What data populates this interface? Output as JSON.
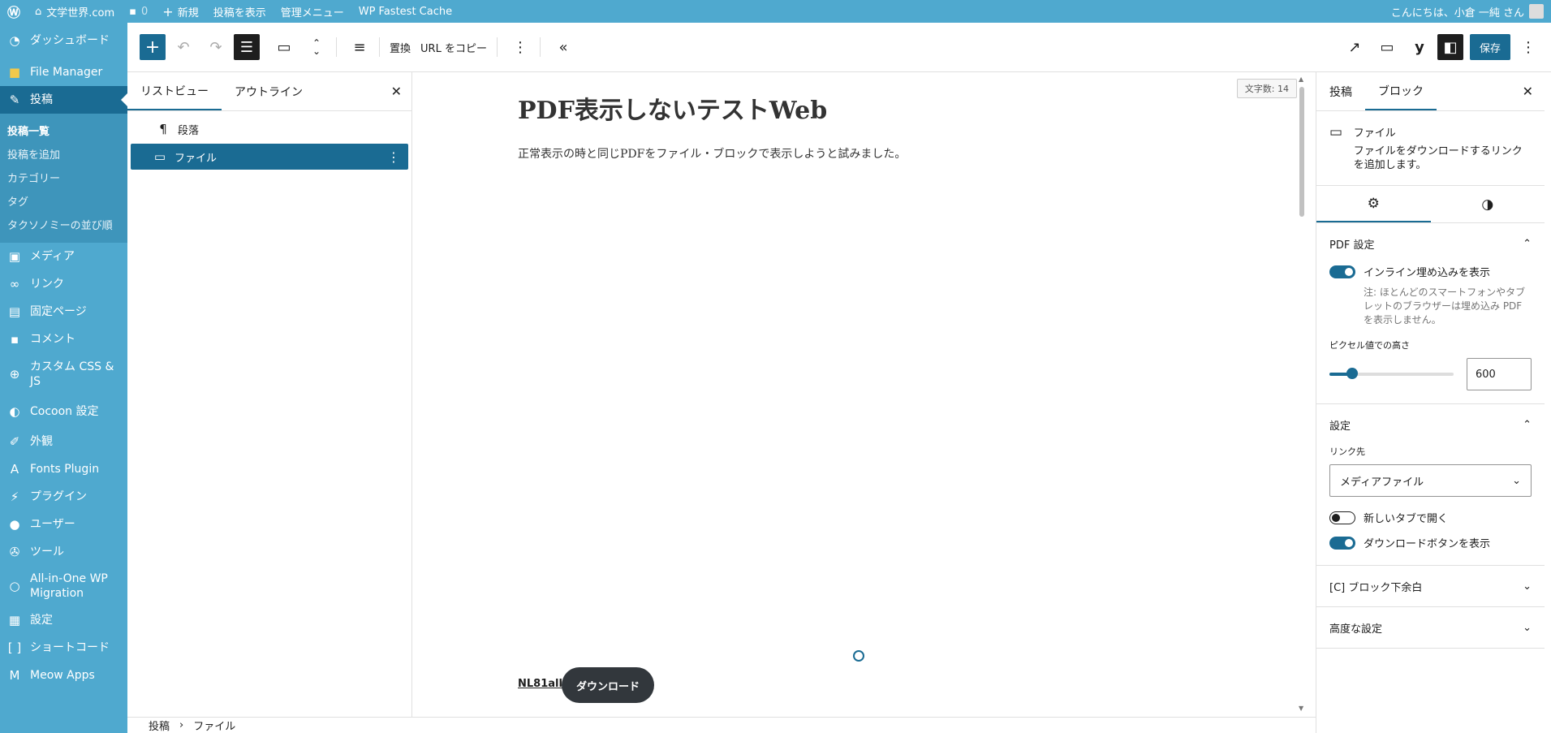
{
  "adminbar": {
    "site_name": "文学世界.com",
    "comments_count": "0",
    "new_label": "新規",
    "view_post": "投稿を表示",
    "admin_menu": "管理メニュー",
    "cache": "WP Fastest Cache",
    "greeting": "こんにちは、小倉 一純 さん"
  },
  "menu": {
    "dashboard": "ダッシュボード",
    "file_manager": "File Manager",
    "posts": "投稿",
    "posts_sub": [
      "投稿一覧",
      "投稿を追加",
      "カテゴリー",
      "タグ",
      "タクソノミーの並び順"
    ],
    "media": "メディア",
    "links": "リンク",
    "pages": "固定ページ",
    "comments": "コメント",
    "custom_css": "カスタム CSS & JS",
    "cocoon": "Cocoon 設定",
    "appearance": "外観",
    "fonts": "Fonts Plugin",
    "plugins": "プラグイン",
    "users": "ユーザー",
    "tools": "ツール",
    "aio": "All-in-One WP Migration",
    "settings": "設定",
    "shortcode": "ショートコード",
    "meow": "Meow Apps"
  },
  "toolbar": {
    "replace": "置換",
    "copy_url": "URL をコピー",
    "save": "保存"
  },
  "listview": {
    "tab_list": "リストビュー",
    "tab_outline": "アウトライン",
    "items": [
      "段落",
      "ファイル"
    ]
  },
  "canvas": {
    "word_count": "文字数: 14",
    "title": "PDF表示しないテストWeb",
    "paragraph": "正常表示の時と同じPDFをファイル・ブロックで表示しようと試みました。",
    "file_name": "NL81all",
    "download": "ダウンロード"
  },
  "sidebar": {
    "tab_post": "投稿",
    "tab_block": "ブロック",
    "block_title": "ファイル",
    "block_desc": "ファイルをダウンロードするリンクを追加します。",
    "pdf_settings": "PDF 設定",
    "inline_embed": "インライン埋め込みを表示",
    "inline_note": "注: ほとんどのスマートフォンやタブレットのブラウザーは埋め込み PDF を表示しません。",
    "height_label": "ピクセル値での高さ",
    "height_value": "600",
    "height_fraction": 0.18,
    "settings": "設定",
    "link_to_label": "リンク先",
    "link_to_value": "メディアファイル",
    "new_tab": "新しいタブで開く",
    "show_download": "ダウンロードボタンを表示",
    "block_margin": "[C] ブロック下余白",
    "advanced": "高度な設定"
  },
  "breadcrumb": [
    "投稿",
    "ファイル"
  ],
  "colors": {
    "admin_blue": "#4fa9cf",
    "accent": "#1a6b93"
  }
}
